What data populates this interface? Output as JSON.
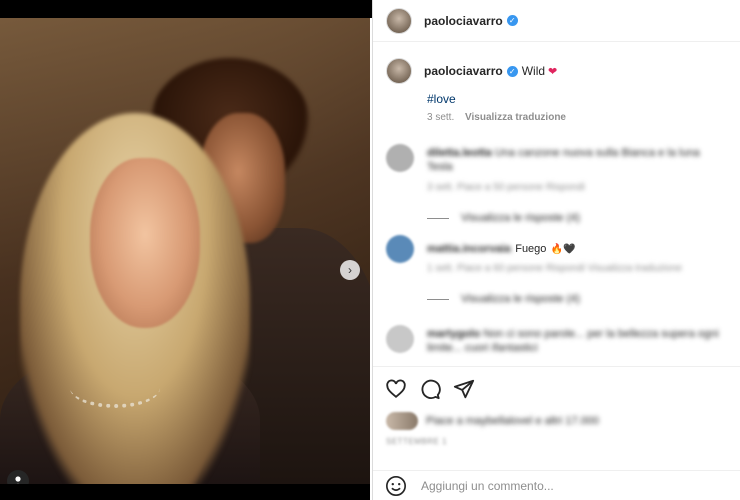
{
  "post": {
    "username": "paolociavarro",
    "caption": "Wild",
    "hashtag": "#love",
    "time": "3 sett.",
    "translate_label": "Visualizza traduzione",
    "carousel": {
      "slide_count": 5,
      "active_index": 0
    }
  },
  "comments": [
    {
      "username": "diletta.leotta",
      "text": "Una canzone nuova sulla Bianca e la luna Tesla",
      "meta": "3 sett.   Piace a 50 persone   Rispondi",
      "replies_label": "Visualizza le risposte (4)",
      "avatar_color": "#b0b0b0"
    },
    {
      "username": "mattia.incorvaia",
      "text": "Fuego",
      "meta": "1 sett.   Piace a 60 persone   Rispondi   Visualizza traduzione",
      "replies_label": "Visualizza le risposte (4)",
      "avatar_color": "#5a8ab8"
    },
    {
      "username": "martygolo",
      "text": "Non ci sono parole... per la bellezza supera ogni limite... cuori ifantastici",
      "meta": "",
      "replies_label": "",
      "avatar_color": "#c8c8c8"
    }
  ],
  "likes": {
    "text": "Piace a maybellalovel e altri 17.000"
  },
  "date": "SETTEMBRE 1",
  "add_comment": {
    "placeholder": "Aggiungi un commento..."
  },
  "colors": {
    "verified": "#3897f0",
    "link": "#00376b",
    "muted": "#8e8e8e"
  }
}
